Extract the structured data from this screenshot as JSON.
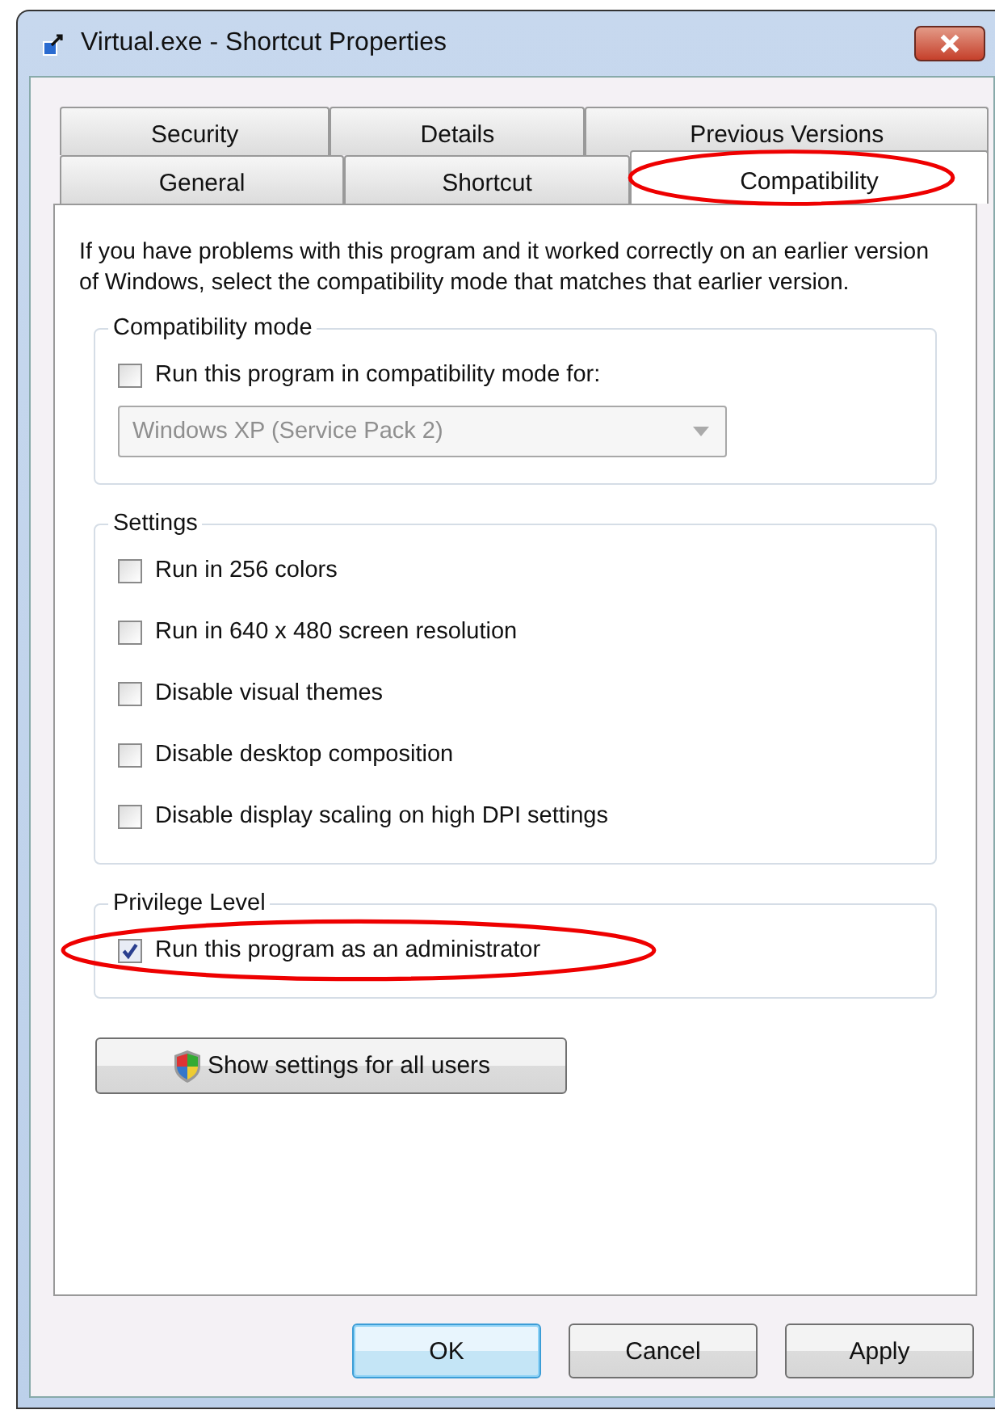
{
  "window": {
    "title": "Virtual.exe - Shortcut Properties"
  },
  "tab_rows": [
    [
      {
        "label": "Security",
        "selected": false,
        "highlighted": false
      },
      {
        "label": "Details",
        "selected": false,
        "highlighted": false
      },
      {
        "label": "Previous Versions",
        "selected": false,
        "highlighted": false
      }
    ],
    [
      {
        "label": "General",
        "selected": false,
        "highlighted": false
      },
      {
        "label": "Shortcut",
        "selected": false,
        "highlighted": false
      },
      {
        "label": "Compatibility",
        "selected": true,
        "highlighted": true
      }
    ]
  ],
  "description": "If you have problems with this program and it worked correctly on an earlier version of Windows, select the compatibility mode that matches that earlier version.",
  "groups": [
    {
      "title": "Compatibility mode",
      "options": [
        {
          "label": "Run this program in compatibility mode for:",
          "checked": false,
          "highlighted": false
        }
      ],
      "dropdown": {
        "value": "Windows XP (Service Pack 2)",
        "disabled": true
      }
    },
    {
      "title": "Settings",
      "options": [
        {
          "label": "Run in 256 colors",
          "checked": false,
          "highlighted": false
        },
        {
          "label": "Run in 640 x 480 screen resolution",
          "checked": false,
          "highlighted": false
        },
        {
          "label": "Disable visual themes",
          "checked": false,
          "highlighted": false
        },
        {
          "label": "Disable desktop composition",
          "checked": false,
          "highlighted": false
        },
        {
          "label": "Disable display scaling on high DPI settings",
          "checked": false,
          "highlighted": false
        }
      ]
    },
    {
      "title": "Privilege Level",
      "options": [
        {
          "label": "Run this program as an administrator",
          "checked": true,
          "highlighted": true
        }
      ]
    }
  ],
  "settings_button": "Show settings for all users",
  "buttons": [
    {
      "label": "OK",
      "default": true
    },
    {
      "label": "Cancel",
      "default": false
    },
    {
      "label": "Apply",
      "default": false
    }
  ]
}
